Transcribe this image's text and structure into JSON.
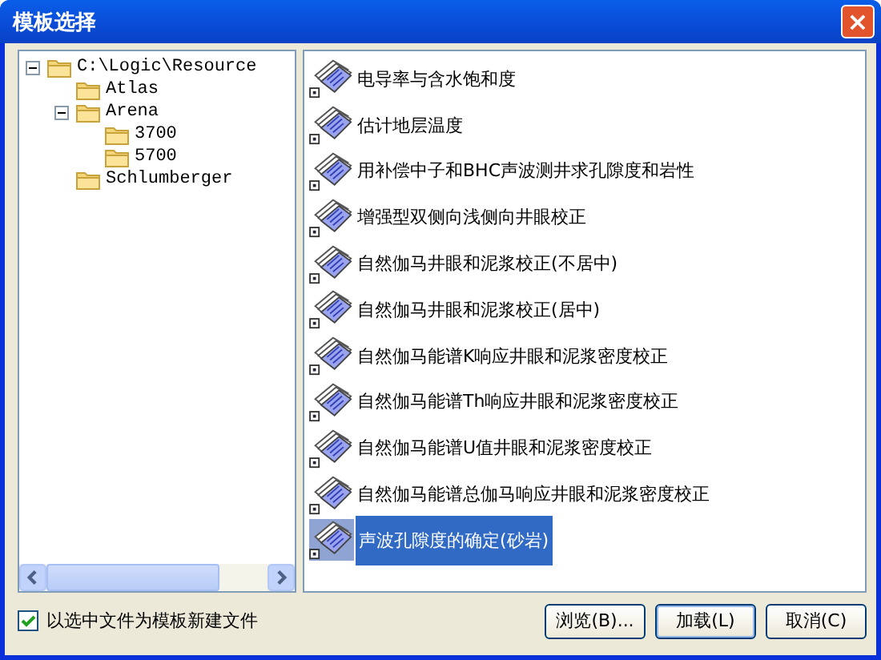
{
  "window": {
    "title": "模板选择",
    "close": "×"
  },
  "tree": [
    {
      "label": "C:\\Logic\\Resource",
      "expanded": true,
      "children": [
        {
          "label": "Atlas"
        },
        {
          "label": "Arena",
          "expanded": true,
          "children": [
            {
              "label": "3700"
            },
            {
              "label": "5700"
            }
          ]
        },
        {
          "label": "Schlumberger"
        }
      ]
    }
  ],
  "templates": [
    {
      "label": "电导率与含水饱和度",
      "selected": false
    },
    {
      "label": "估计地层温度",
      "selected": false
    },
    {
      "label": "用补偿中子和BHC声波测井求孔隙度和岩性",
      "selected": false
    },
    {
      "label": "增强型双侧向浅侧向井眼校正",
      "selected": false
    },
    {
      "label": "自然伽马井眼和泥浆校正(不居中)",
      "selected": false
    },
    {
      "label": "自然伽马井眼和泥浆校正(居中)",
      "selected": false
    },
    {
      "label": "自然伽马能谱K响应井眼和泥浆密度校正",
      "selected": false
    },
    {
      "label": "自然伽马能谱Th响应井眼和泥浆密度校正",
      "selected": false
    },
    {
      "label": "自然伽马能谱U值井眼和泥浆密度校正",
      "selected": false
    },
    {
      "label": "自然伽马能谱总伽马响应井眼和泥浆密度校正",
      "selected": false
    },
    {
      "label": "声波孔隙度的确定(砂岩)",
      "selected": true
    }
  ],
  "new_from_selected": {
    "label": "以选中文件为模板新建文件",
    "checked": true
  },
  "buttons": [
    {
      "label": "浏览(B)...",
      "default": false
    },
    {
      "label": "加载(L)",
      "default": true
    },
    {
      "label": "取消(C)",
      "default": false
    }
  ]
}
